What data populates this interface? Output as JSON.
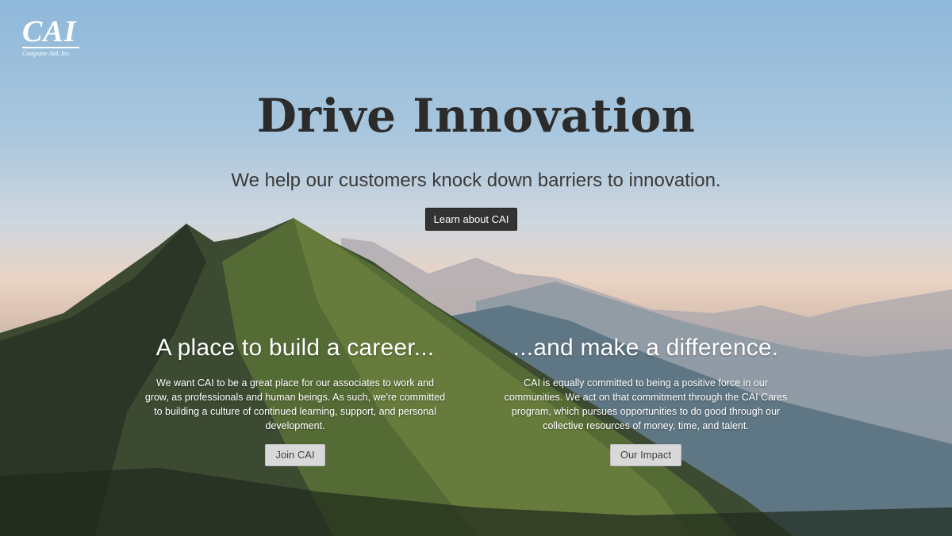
{
  "logo": {
    "mark": "CAI",
    "subtitle": "Computer Aid, Inc."
  },
  "hero": {
    "headline": "Drive Innovation",
    "tagline": "We help our customers knock down barriers to innovation.",
    "cta_label": "Learn about CAI"
  },
  "columns": [
    {
      "title": "A place to build a career...",
      "body": "We want CAI to be a great place for our associates to work and grow, as professionals and human beings. As such, we're committed to building a culture of continued learning, support, and personal development.",
      "button_label": "Join CAI"
    },
    {
      "title": "...and make a difference.",
      "body": "CAI is equally committed to being a positive force in our communities. We act on that commitment through the CAI Cares program, which pursues opportunities to do good through our collective resources of money, time, and talent.",
      "button_label": "Our Impact"
    }
  ],
  "colors": {
    "headline": "#2b2b2b",
    "cta_bg": "#333333",
    "light_button_bg": "#d9d9d9"
  }
}
